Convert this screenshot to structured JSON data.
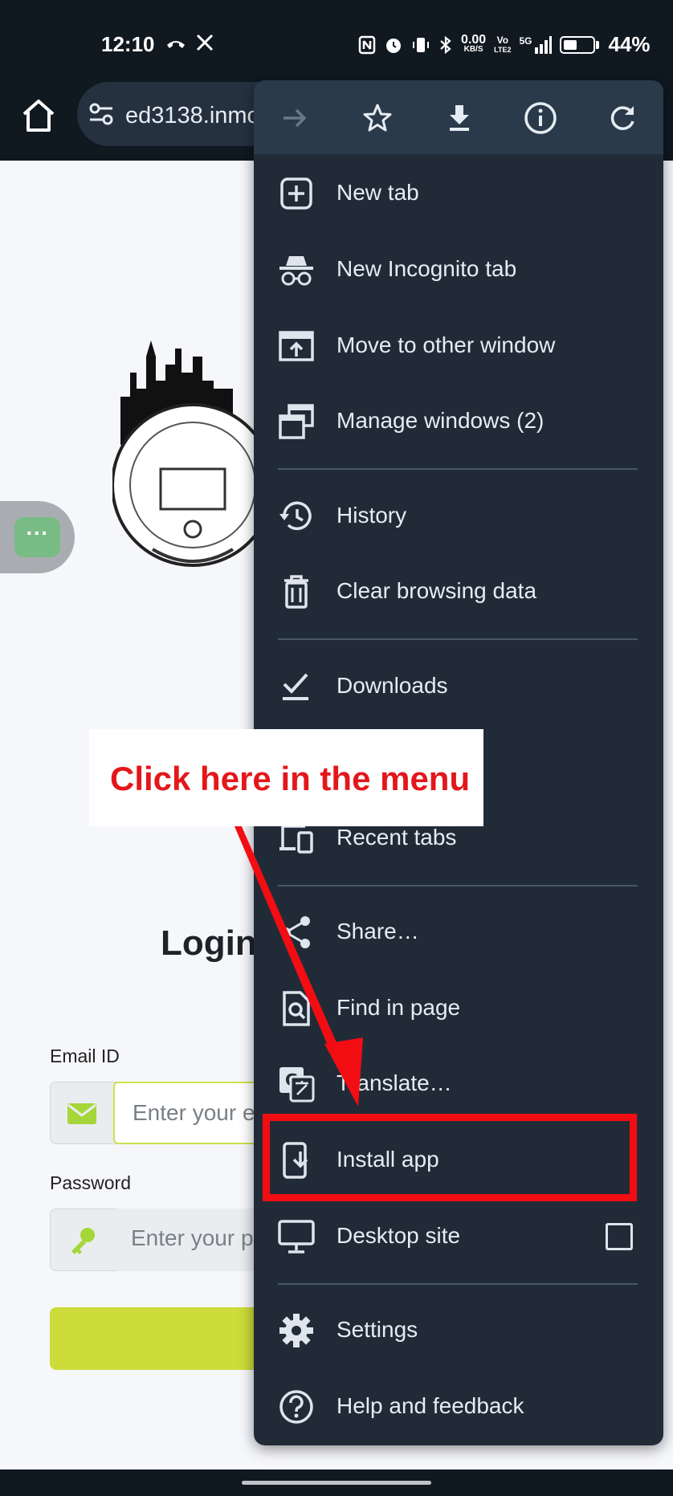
{
  "status_bar": {
    "time": "12:10",
    "net_speed_top": "0.00",
    "net_speed_unit": "KB/S",
    "volte_top": "Vo",
    "volte_bottom": "LTE2",
    "network": "5G",
    "battery_percent": "44%"
  },
  "toolbar": {
    "url": "ed3138.inmo"
  },
  "menu": {
    "toolbar_icons": [
      "forward-icon",
      "bookmark-star-icon",
      "download-icon",
      "info-icon",
      "refresh-icon"
    ],
    "items": [
      {
        "label": "New tab",
        "icon": "new-tab-icon"
      },
      {
        "label": "New Incognito tab",
        "icon": "incognito-icon"
      },
      {
        "label": "Move to other window",
        "icon": "move-window-icon"
      },
      {
        "label": "Manage windows (2)",
        "icon": "manage-windows-icon"
      },
      {
        "label": "History",
        "icon": "history-icon"
      },
      {
        "label": "Clear browsing data",
        "icon": "trash-icon"
      },
      {
        "label": "Downloads",
        "icon": "downloads-icon"
      },
      {
        "label": "Recent tabs",
        "icon": "recent-tabs-icon"
      },
      {
        "label": "Share…",
        "icon": "share-icon"
      },
      {
        "label": "Find in page",
        "icon": "find-in-page-icon"
      },
      {
        "label": "Translate…",
        "icon": "translate-icon"
      },
      {
        "label": "Install app",
        "icon": "install-app-icon"
      },
      {
        "label": "Desktop site",
        "icon": "desktop-icon",
        "checked": false
      },
      {
        "label": "Settings",
        "icon": "settings-icon"
      },
      {
        "label": "Help and feedback",
        "icon": "help-icon"
      }
    ]
  },
  "page": {
    "login_title": "Login",
    "email_label": "Email ID",
    "email_placeholder": "Enter your e",
    "password_label": "Password",
    "password_placeholder": "Enter your p",
    "accent_color": "#cddc3a"
  },
  "annotation": {
    "callout_text": "Click here in the menu",
    "highlight_color": "#f20d12"
  }
}
